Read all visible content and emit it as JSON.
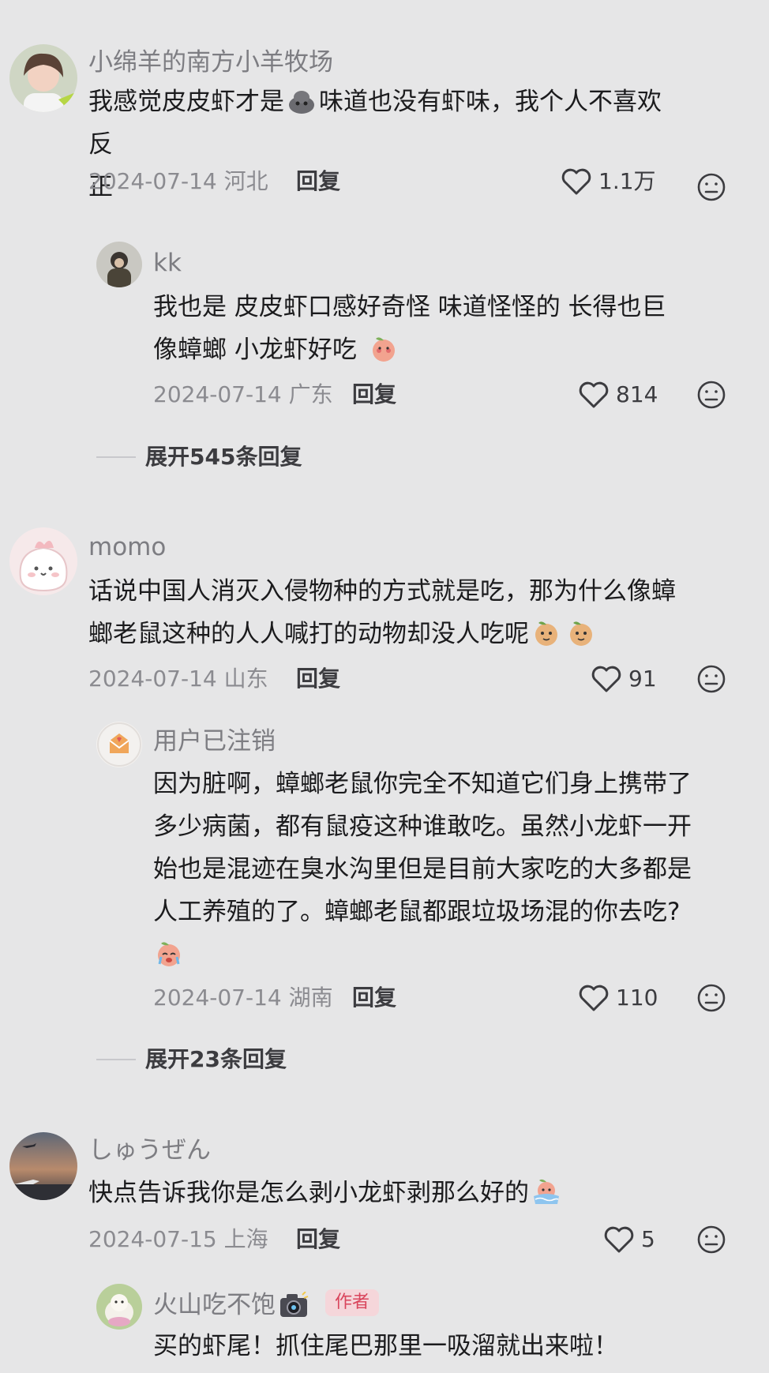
{
  "comments": [
    {
      "author": "小绵羊的南方小羊牧场",
      "text_lines": [
        "我感觉皮皮虾才是",
        "味道也没有虾味，我个人不喜欢反",
        "正"
      ],
      "date": "2024-07-14 河北",
      "reply": "回复",
      "likes": "1.1万",
      "sub_reply": {
        "author": "kk",
        "text_lines": [
          "我也是  皮皮虾口感好奇怪  味道怪怪的  长得也巨",
          "像蟑螂  小龙虾好吃"
        ],
        "date": "2024-07-14 广东",
        "reply": "回复",
        "likes": "814"
      },
      "expand": "展开545条回复"
    },
    {
      "author": "momo",
      "text_lines": [
        "话说中国人消灭入侵物种的方式就是吃，那为什么像蟑",
        "螂老鼠这种的人人喊打的动物却没人吃呢"
      ],
      "date": "2024-07-14 山东",
      "reply": "回复",
      "likes": "91",
      "sub_reply": {
        "author": "用户已注销",
        "text_lines": [
          "因为脏啊，蟑螂老鼠你完全不知道它们身上携带了",
          "多少病菌，都有鼠疫这种谁敢吃。虽然小龙虾一开",
          "始也是混迹在臭水沟里但是目前大家吃的大多都是",
          "人工养殖的了。蟑螂老鼠都跟垃圾场混的你去吃?"
        ],
        "date": "2024-07-14 湖南",
        "reply": "回复",
        "likes": "110"
      },
      "expand": "展开23条回复"
    },
    {
      "author": "しゅうぜん",
      "text_lines": [
        "快点告诉我你是怎么剥小龙虾剥那么好的"
      ],
      "date": "2024-07-15 上海",
      "reply": "回复",
      "likes": "5",
      "sub_reply": {
        "author": "火山吃不饱",
        "badge": "作者",
        "text_lines": [
          "买的虾尾！抓住尾巴那里一吸溜就出来啦！"
        ]
      }
    }
  ]
}
